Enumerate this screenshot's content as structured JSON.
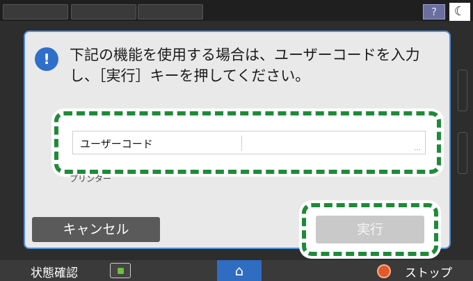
{
  "dialog": {
    "message_line1": "下記の機能を使用する場合は、ユーザーコードを入力",
    "message_line2": "し、［実行］キーを押してください。",
    "user_code_label": "ユーザーコード",
    "user_code_value": "",
    "field_more": "…",
    "function_label": "プリンター",
    "cancel_label": "キャンセル",
    "execute_label": "実行"
  },
  "topbar": {
    "help_label": "?",
    "night_mode_icon": "moon-icon"
  },
  "bottombar": {
    "status_label": "状態確認",
    "home_icon": "home-icon",
    "stop_label": "ストップ"
  },
  "colors": {
    "accent_blue": "#2f6fc9",
    "highlight_green": "#1f8a3a",
    "stop_orange": "#e05a2a"
  }
}
